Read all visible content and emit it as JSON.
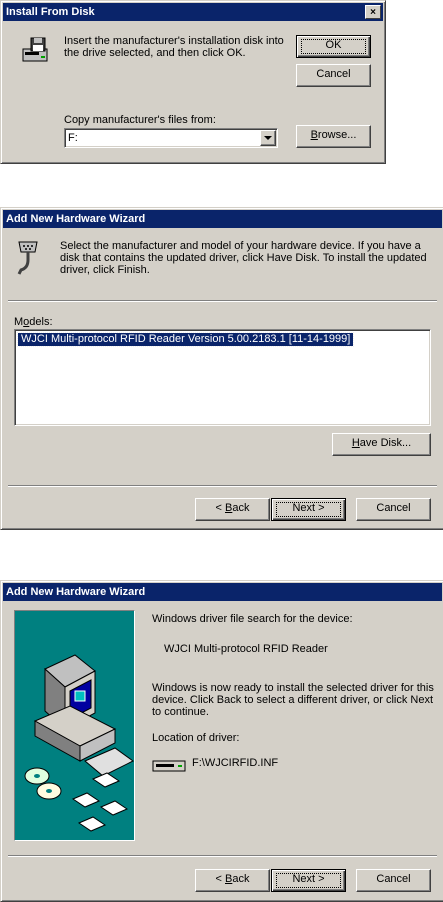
{
  "dialog1": {
    "title": "Install From Disk",
    "close": "×",
    "message_line1": "Insert the manufacturer's installation disk into",
    "message_line2": "the drive selected, and then click OK.",
    "ok": "OK",
    "cancel": "Cancel",
    "copy_label": "Copy manufacturer's files from:",
    "path_value": "F:",
    "browse_rest": "rowse...",
    "browse_ul": "B"
  },
  "dialog2": {
    "title": "Add New Hardware Wizard",
    "instruction_line1": "Select the manufacturer and model of your hardware device. If you have a",
    "instruction_line2": "disk that contains the updated driver, click Have Disk. To install the updated",
    "instruction_line3": "driver, click Finish.",
    "models_ul": "o",
    "models_pre": "M",
    "models_post": "dels:",
    "model_item": "WJCI Multi-protocol RFID Reader Version 5.00.2183.1 [11-14-1999]",
    "have_disk_ul": "H",
    "have_disk_rest": "ave Disk...",
    "back_pre": "< ",
    "back_ul": "B",
    "back_rest": "ack",
    "next": "Next >",
    "cancel": "Cancel"
  },
  "dialog3": {
    "title": "Add New Hardware Wizard",
    "search_label": "Windows driver file search for the device:",
    "device_name": "WJCI Multi-protocol RFID Reader",
    "ready_line1": "Windows is now ready to install the selected driver for this",
    "ready_line2": "device. Click Back to select a different driver, or click Next",
    "ready_line3": "to continue.",
    "location_label": "Location of driver:",
    "driver_path": "F:\\WJCIRFID.INF",
    "back_pre": "< ",
    "back_ul": "B",
    "back_rest": "ack",
    "next": "Next >",
    "cancel": "Cancel"
  },
  "colors": {
    "titlebar": "#0a246a",
    "face": "#d4d0c8",
    "selection": "#0a246a",
    "wizard_panel": "#008080"
  },
  "icons": [
    "floppy-drive-icon",
    "serial-connector-icon",
    "computer-cd-icon",
    "disk-drive-icon",
    "dropdown-arrow-icon"
  ]
}
